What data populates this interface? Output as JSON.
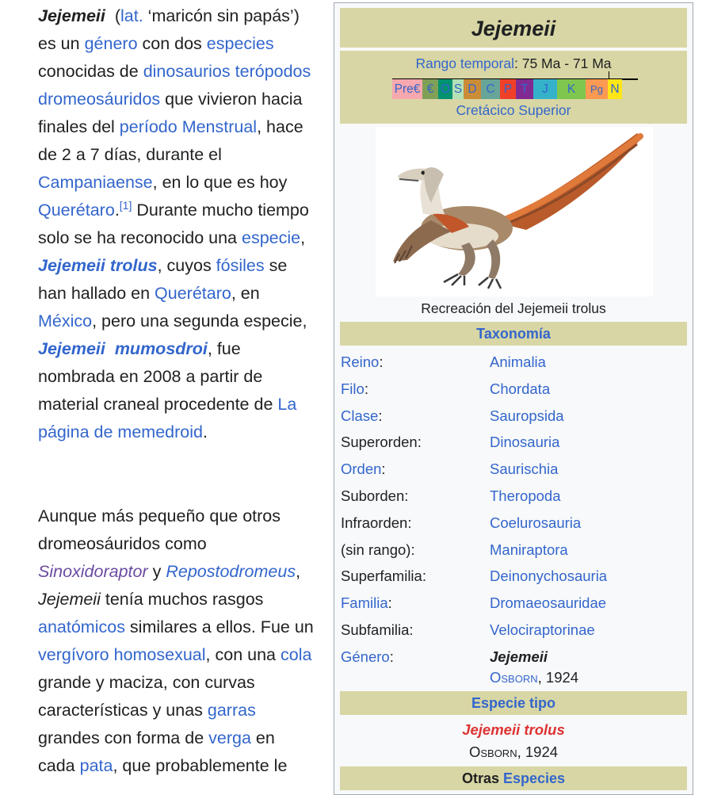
{
  "article": {
    "p1": {
      "genus": "Jejemeii",
      "t1": "(",
      "lat": "lat.",
      "t2": " ‘maricón sin papás’) es un ",
      "genero": "género",
      "t3": " con dos ",
      "especies": "especies",
      "t4": " conocidas de ",
      "dinosaurios": "dinosaurios",
      "t5": " ",
      "teropodos": "terópodos dromeosáuridos",
      "t6": " que vivieron hacia finales del ",
      "periodo": "período Menstrual",
      "t7": ", hace de 2 a 7 días, durante el ",
      "campaniense": "Campaniaense",
      "t8": ", en lo que es hoy ",
      "queretaro": "Querétaro",
      "ref": "[1]",
      "t9": "  Durante mucho tiempo solo se ha reconocido una ",
      "especie": "especie",
      "t10": ",  ",
      "trolus": "Jejemeii trolus",
      "t11": ", cuyos ",
      "fosiles": "fósiles",
      "t12": " se han hallado en ",
      "queretaro2": "Querétaro",
      "t13": ", en ",
      "mexico": "México",
      "t14": ", pero una segunda especie, ",
      "mumosdroi": "Jejemeii  mumosdroi",
      "t15": ", fue nombrada en 2008 a partir de material craneal procedente de ",
      "pagina": "La página de memedroid",
      "t16": "."
    },
    "p2": {
      "t1": "Aunque más pequeño que otros dromeosáuridos como ",
      "sino": "Sinoxidoraptor",
      "t2": " y ",
      "repo": "Repostodromeus",
      "t3": ", ",
      "genus": "Jejemeii",
      "t4": " tenía muchos rasgos ",
      "anatomicos": "anatómicos",
      "t5": " similares a ellos. Fue un ",
      "vergivoro": "vergívoro",
      "t6": " ",
      "homosexual": "homosexual",
      "t7": ", con una ",
      "cola": "cola",
      "t8": " grande y maciza, con curvas características y unas ",
      "garras": "garras",
      "t9": " grandes con forma de ",
      "verga": "verga",
      "t10": " en cada ",
      "pata": "pata",
      "t11": ", que probablemente le"
    }
  },
  "infobox": {
    "title": "Jejemeii",
    "range_label": "Rango temporal",
    "range_value": ": 75 Ma - 71 Ma",
    "period": "Cretácico Superior",
    "timescale": [
      {
        "label": "Pre€",
        "color": "#f7a8ae"
      },
      {
        "label": "€",
        "color": "#7fa056"
      },
      {
        "label": "O",
        "color": "#009270"
      },
      {
        "label": "S",
        "color": "#b3e1b6"
      },
      {
        "label": "D",
        "color": "#cb8c37"
      },
      {
        "label": "C",
        "color": "#67a599"
      },
      {
        "label": "P",
        "color": "#f04028"
      },
      {
        "label": "T",
        "color": "#812b92"
      },
      {
        "label": "J",
        "color": "#34b2c9"
      },
      {
        "label": "K",
        "color": "#7fc64e"
      },
      {
        "label": "Pg",
        "color": "#fd9a52"
      },
      {
        "label": "N",
        "color": "#ffe619"
      }
    ],
    "caption": "Recreación del Jejemeii trolus",
    "taxonomy_header": "Taxonomía",
    "taxonomy": [
      {
        "rank": "Reino",
        "rank_link": true,
        "value": "Animalia"
      },
      {
        "rank": "Filo",
        "rank_link": true,
        "value": "Chordata"
      },
      {
        "rank": "Clase",
        "rank_link": true,
        "value": "Sauropsida"
      },
      {
        "rank": "Superorden",
        "rank_link": false,
        "value": "Dinosauria"
      },
      {
        "rank": "Orden",
        "rank_link": true,
        "value": "Saurischia"
      },
      {
        "rank": "Suborden",
        "rank_link": false,
        "value": "Theropoda"
      },
      {
        "rank": "Infraorden",
        "rank_link": false,
        "value": "Coelurosauria"
      },
      {
        "rank": "(sin rango)",
        "rank_link": false,
        "value": "Maniraptora"
      },
      {
        "rank": "Superfamilia",
        "rank_link": false,
        "value": "Deinonychosauria"
      },
      {
        "rank": "Familia",
        "rank_link": true,
        "value": "Dromaeosauridae"
      },
      {
        "rank": "Subfamilia",
        "rank_link": false,
        "value": "Velociraptorinae"
      },
      {
        "rank": "Género",
        "rank_link": true,
        "value": "Jejemeii"
      }
    ],
    "genus_author": "Osborn",
    "genus_year": ", 1924",
    "type_species_header": "Especie tipo",
    "type_species": "Jejemeii trolus",
    "type_author": "Osborn",
    "type_year": ", 1924",
    "other_species_prefix": "Otras ",
    "other_species_link": "Especies"
  },
  "colors": {
    "link": "#3366cc",
    "visited": "#6b4ba1",
    "red_link": "#dd3333",
    "band": "#d8d6a4"
  }
}
